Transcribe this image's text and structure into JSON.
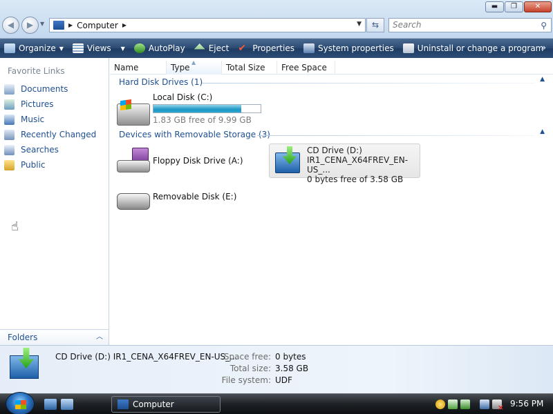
{
  "window": {
    "minimize": "▬",
    "maximize": "❐",
    "close": "✕"
  },
  "address": {
    "crumb": "Computer",
    "search_placeholder": "Search"
  },
  "commands": [
    {
      "label": "Organize",
      "icon": "organize-icon",
      "dropdown": true
    },
    {
      "label": "Views",
      "icon": "views-icon",
      "dropdown": true
    },
    {
      "label": "AutoPlay",
      "icon": "autoplay-icon",
      "dropdown": false
    },
    {
      "label": "Eject",
      "icon": "eject-icon",
      "dropdown": false
    },
    {
      "label": "Properties",
      "icon": "properties-icon",
      "dropdown": false
    },
    {
      "label": "System properties",
      "icon": "system-properties-icon",
      "dropdown": false
    },
    {
      "label": "Uninstall or change a program",
      "icon": "uninstall-icon",
      "dropdown": false
    }
  ],
  "nav": {
    "favorites_title": "Favorite Links",
    "items": [
      {
        "label": "Documents",
        "icon": "documents-icon"
      },
      {
        "label": "Pictures",
        "icon": "pictures-icon"
      },
      {
        "label": "Music",
        "icon": "music-icon"
      },
      {
        "label": "Recently Changed",
        "icon": "recently-changed-icon"
      },
      {
        "label": "Searches",
        "icon": "searches-icon"
      },
      {
        "label": "Public",
        "icon": "public-folder-icon"
      }
    ],
    "folders_label": "Folders"
  },
  "columns": [
    "Name",
    "Type",
    "Total Size",
    "Free Space"
  ],
  "groups": {
    "hdd": "Hard Disk Drives (1)",
    "removable": "Devices with Removable Storage (3)"
  },
  "drives": {
    "c": {
      "name": "Local Disk (C:)",
      "free_text": "1.83 GB free of 9.99 GB",
      "used_fraction": 0.817
    },
    "a": {
      "name": "Floppy Disk Drive (A:)"
    },
    "d": {
      "name": "CD Drive (D:)",
      "label": "IR1_CENA_X64FREV_EN-US_...",
      "free_text": "0 bytes free of 3.58 GB"
    },
    "e": {
      "name": "Removable Disk (E:)"
    }
  },
  "details": {
    "title": "CD Drive (D:) IR1_CENA_X64FREV_EN-US_...",
    "space_free_label": "Space free:",
    "space_free": "0 bytes",
    "total_size_label": "Total size:",
    "total_size": "3.58 GB",
    "file_system_label": "File system:",
    "file_system": "UDF"
  },
  "taskbar": {
    "task_label": "Computer",
    "clock": "9:56 PM"
  }
}
